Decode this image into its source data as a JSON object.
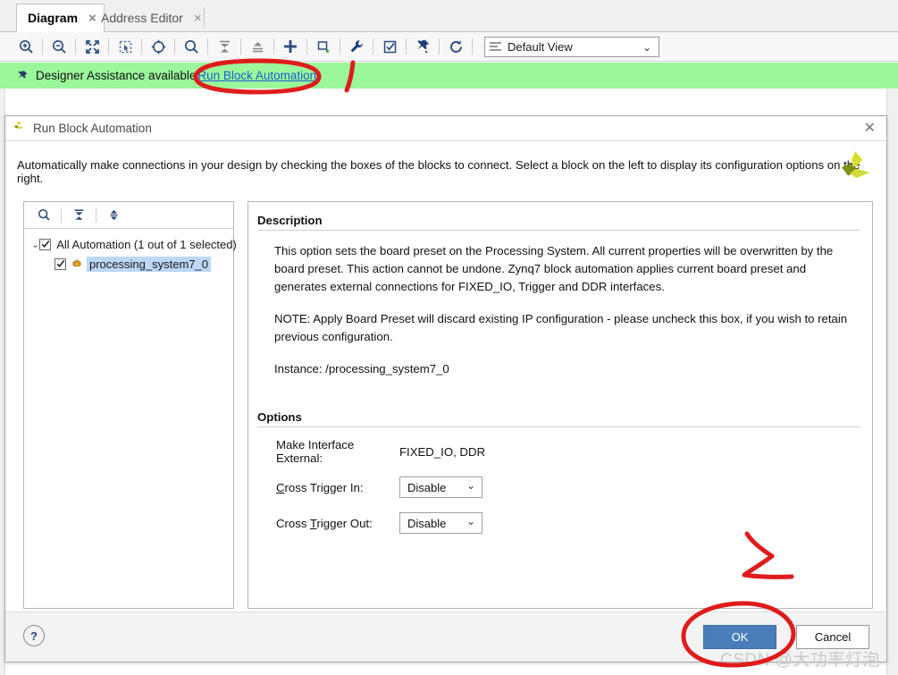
{
  "window": {
    "tabs": [
      {
        "label": "Diagram",
        "active": true,
        "close": "×"
      },
      {
        "label": "Address Editor",
        "active": false,
        "close": "×"
      }
    ],
    "toolbar": {
      "buttons": [
        {
          "name": "zoom-in-icon",
          "title": "Zoom In"
        },
        {
          "name": "zoom-out-icon",
          "title": "Zoom Out"
        },
        {
          "name": "zoom-fit-icon",
          "title": "Zoom Fit"
        },
        {
          "name": "zoom-area-icon",
          "title": "Zoom Area"
        },
        {
          "name": "fit-selection-icon",
          "title": "Fit Selection"
        },
        {
          "name": "search-icon",
          "title": "Search"
        },
        {
          "name": "collapse-all-icon",
          "title": "Collapse All"
        },
        {
          "name": "expand-all-icon",
          "title": "Expand All"
        },
        {
          "name": "add-ip-icon",
          "title": "Add IP"
        },
        {
          "name": "add-module-icon",
          "title": "Add Module"
        },
        {
          "name": "block-properties-icon",
          "title": "Block Properties"
        },
        {
          "name": "validate-design-icon",
          "title": "Validate Design"
        },
        {
          "name": "pin-icon",
          "title": "Pin"
        },
        {
          "name": "regenerate-layout-icon",
          "title": "Regenerate Layout"
        },
        {
          "name": "optimize-routing-icon",
          "title": "Optimize Routing"
        }
      ]
    },
    "view_select": {
      "value": "Default View",
      "arrow": "⌄"
    },
    "assist_bar": {
      "message": "Designer Assistance available",
      "link": "Run Block Automation"
    }
  },
  "dialog": {
    "title": "Run Block Automation",
    "close": "✕",
    "intro": "Automatically make connections in your design by checking the boxes of the blocks to connect. Select a block on the left to display its configuration options on the right.",
    "tree": {
      "toolbar": [
        {
          "name": "search-icon"
        },
        {
          "name": "collapse-all-icon"
        },
        {
          "name": "expand-all-icon"
        }
      ],
      "rows": [
        {
          "label": "All Automation (1 out of 1 selected)",
          "checked": true,
          "expanded": true,
          "twisty": "⌄",
          "child": false,
          "selected": false
        },
        {
          "label": "processing_system7_0",
          "checked": true,
          "child": true,
          "selected": true
        }
      ]
    },
    "detail": {
      "description_heading": "Description",
      "description_paragraphs": [
        "This option sets the board preset on the Processing System. All current properties will be overwritten by the board preset. This action cannot be undone. Zynq7 block automation applies current board preset and generates external connections for FIXED_IO, Trigger and DDR interfaces.",
        "NOTE: Apply Board Preset will discard existing IP configuration - please uncheck this box, if you wish to retain previous configuration.",
        "Instance: /processing_system7_0"
      ],
      "options_heading": "Options",
      "options": [
        {
          "label": "Make Interface External:",
          "type": "text",
          "value": "FIXED_IO, DDR"
        },
        {
          "label_pre": "",
          "label_mnemonic": "C",
          "label_post": "ross Trigger In:",
          "type": "combo",
          "value": "Disable",
          "arrow": "⌄"
        },
        {
          "label_pre": "Cross ",
          "label_mnemonic": "T",
          "label_post": "rigger Out:",
          "type": "combo",
          "value": "Disable",
          "arrow": "⌄"
        }
      ]
    },
    "footer": {
      "help": "?",
      "ok": "OK",
      "cancel": "Cancel"
    }
  },
  "watermark": "CSDN @大功率灯泡",
  "colors": {
    "assist_green": "#9af79a",
    "link_blue": "#1a5fd0",
    "primary_button": "#4a7ebb",
    "annotation_red": "#e01b1b",
    "selection_blue": "#bcd7f7"
  }
}
